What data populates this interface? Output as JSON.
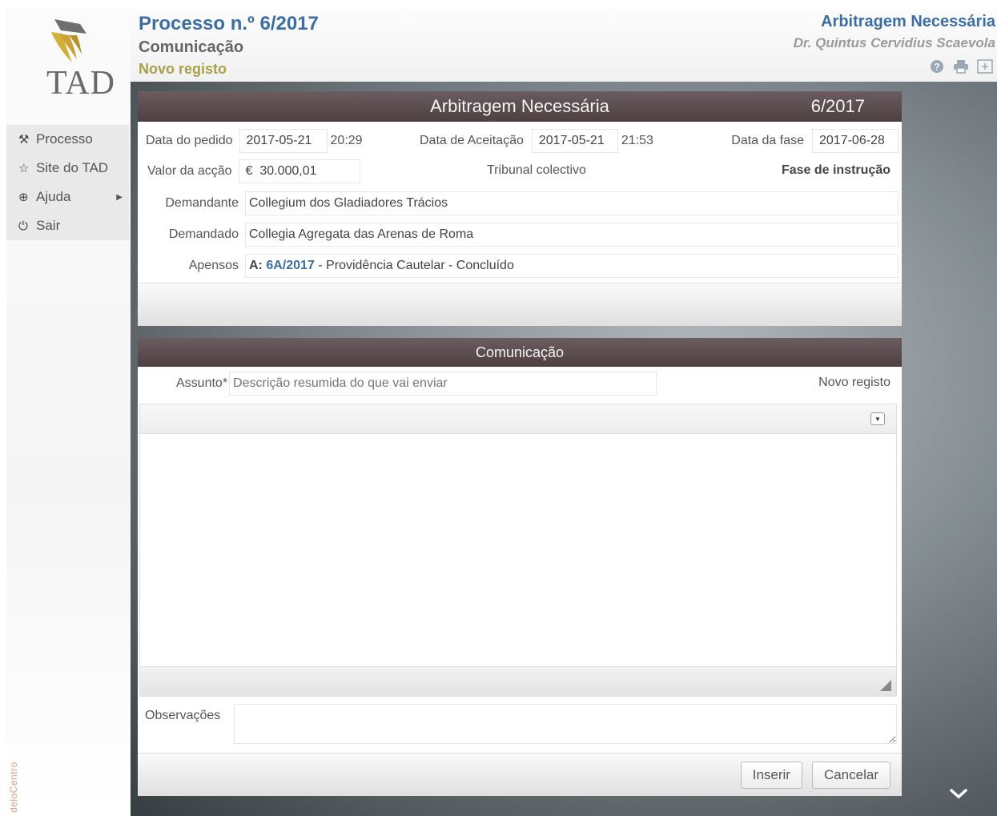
{
  "logo": {
    "text": "TAD"
  },
  "sidebar": {
    "items": [
      {
        "label": "Processo",
        "icon": "gavel-icon"
      },
      {
        "label": "Site do TAD",
        "icon": "star-icon"
      },
      {
        "label": "Ajuda",
        "icon": "lifebuoy-icon"
      },
      {
        "label": "Sair",
        "icon": "power-icon"
      }
    ],
    "brand": "deloCentro"
  },
  "header": {
    "title": "Processo n.º 6/2017",
    "subtitle": "Comunicação",
    "status": "Novo registo",
    "right_title": "Arbitragem Necessária",
    "user": "Dr. Quintus Cervidius Scaevola"
  },
  "process_panel": {
    "title": "Arbitragem Necessária",
    "number": "6/2017",
    "data_pedido_label": "Data do pedido",
    "data_pedido_date": "2017-05-21",
    "data_pedido_time": "20:29",
    "data_aceitacao_label": "Data de Aceitação",
    "data_aceitacao_date": "2017-05-21",
    "data_aceitacao_time": "21:53",
    "data_fase_label": "Data da fase",
    "data_fase_date": "2017-06-28",
    "valor_label": "Valor da acção",
    "valor": "€  30.000,01",
    "tribunal": "Tribunal colectivo",
    "fase": "Fase de instrução",
    "demandante_label": "Demandante",
    "demandante": "Collegium dos Gladiadores Trácios",
    "demandado_label": "Demandado",
    "demandado": "Collegia Agregata das Arenas de Roma",
    "apensos_label": "Apensos",
    "apensos_prefix": "A:",
    "apensos_link": "6A/2017",
    "apensos_rest": " - Providência Cautelar - Concluído"
  },
  "comm_panel": {
    "title": "Comunicação",
    "assunto_label": "Assunto",
    "assunto_required": "*",
    "assunto_placeholder": "Descrição resumida do que vai enviar",
    "status": "Novo registo",
    "observacoes_label": "Observações",
    "insert_label": "Inserir",
    "cancel_label": "Cancelar"
  }
}
